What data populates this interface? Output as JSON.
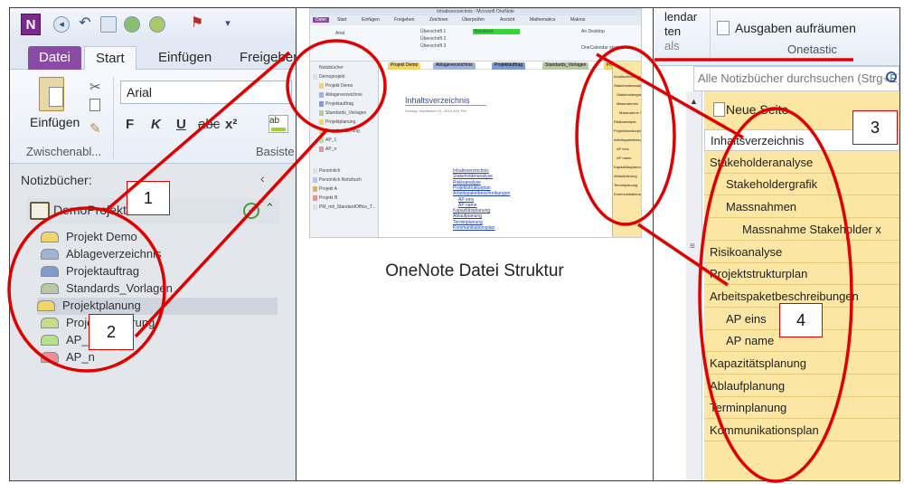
{
  "left": {
    "onenote_icon": "N",
    "tabs": {
      "file": "Datei",
      "start": "Start",
      "insert": "Einfügen",
      "share": "Freigeben"
    },
    "ribbon": {
      "paste_label": "Einfügen",
      "clipboard_group": "Zwischenabl...",
      "font_name": "Arial",
      "basic_group": "Basiste",
      "bold": "F",
      "italic": "K",
      "underline": "U",
      "strike": "abc",
      "superscript": "x²",
      "highlight": "ab"
    },
    "notebooks_header": "Notizbücher:",
    "notebook_name": "DemoProjekt",
    "sections": [
      {
        "label": "Projekt Demo",
        "color": "#f2d56a"
      },
      {
        "label": "Ablageverzeichnis",
        "color": "#9fb4d8"
      },
      {
        "label": "Projektauftrag",
        "color": "#7f9bd0"
      },
      {
        "label": "Standards_Vorlagen",
        "color": "#b9c7a5"
      },
      {
        "label": "Projektplanung",
        "color": "#f2d56a"
      },
      {
        "label": "Projektsteuerung",
        "color": "#c7dd8a"
      },
      {
        "label": "AP_1",
        "color": "#b6e08a"
      },
      {
        "label": "AP_n",
        "color": "#e9909a"
      }
    ]
  },
  "middle": {
    "caption": "OneNote Datei Struktur",
    "window_title": "Inhaltsverzeichnis - Microsoft OneNote",
    "tabs": [
      "Datei",
      "Start",
      "Einfügen",
      "Freigeben",
      "Zeichnen",
      "Überprüfen",
      "Ansicht",
      "Mathematics",
      "Makros"
    ],
    "ribbon_bits": {
      "heading1": "Überschrift 1",
      "heading2": "Überschrift 2",
      "heading3": "Überschrift 3",
      "basic": "Basistext",
      "font": "Arial",
      "onenote_btn": "OneCalendar starten",
      "to_desktop": "An Desktop"
    },
    "nav_items": [
      "Notizbücher",
      "Demoprojekt",
      "Projekt Demo",
      "Ablageverzeichnis",
      "Projektauftrag",
      "Standards_Vorlagen",
      "Projektplanung",
      "Projektsteuerung",
      "AP_1",
      "AP_n",
      "Persönlich",
      "Persönlich Notizbuch",
      "Projekt A",
      "Projekt B",
      "PM_mit_StandardOffice_T..."
    ],
    "section_tabs": [
      "Projekt Demo",
      "Ablageverzeichnis",
      "Projektauftrag",
      "Standards_Vorlagen",
      "Projektplanung"
    ],
    "page_title": "Inhaltsverzeichnis",
    "page_date": "Sunday, September 01, 2013   4:01 PM",
    "toc": [
      "Inhaltsverzeichnis",
      "Stakeholderanalyse",
      "Risikoanalyse",
      "Projektstrukturplan",
      "Arbeitspaketbeschreibungen",
      "AP eins",
      "AP name",
      "Kapazitätsplanung",
      "Ablaufplanung",
      "Terminplanung",
      "Kommunikationsplan"
    ]
  },
  "right": {
    "calendar_text": "lendar",
    "ten_text": "ten",
    "als_text": "als",
    "ausgaben": "Ausgaben aufräumen",
    "onetastic": "Onetastic",
    "search_placeholder": "Alle Notizbücher durchsuchen (Strg+E)",
    "new_page": "Neue Seite",
    "pages": [
      {
        "label": "Inhaltsverzeichnis",
        "level": 0
      },
      {
        "label": "Stakeholderanalyse",
        "level": 0
      },
      {
        "label": "Stakeholdergrafik",
        "level": 1
      },
      {
        "label": "Massnahmen",
        "level": 1
      },
      {
        "label": "Massnahme  Stakeholder x",
        "level": 2
      },
      {
        "label": "Risikoanalyse",
        "level": 0
      },
      {
        "label": "Projektstrukturplan",
        "level": 0
      },
      {
        "label": "Arbeitspaketbeschreibungen",
        "level": 0
      },
      {
        "label": "AP eins",
        "level": 1
      },
      {
        "label": "AP name",
        "level": 1
      },
      {
        "label": "Kapazitätsplanung",
        "level": 0
      },
      {
        "label": "Ablaufplanung",
        "level": 0
      },
      {
        "label": "Terminplanung",
        "level": 0
      },
      {
        "label": "Kommunikationsplan",
        "level": 0
      }
    ]
  },
  "callouts": [
    "1",
    "2",
    "3",
    "4"
  ],
  "colors": {
    "annotation": "#e00000",
    "page_list": "#fce6a3",
    "file_tab": "#8b4aa6"
  }
}
